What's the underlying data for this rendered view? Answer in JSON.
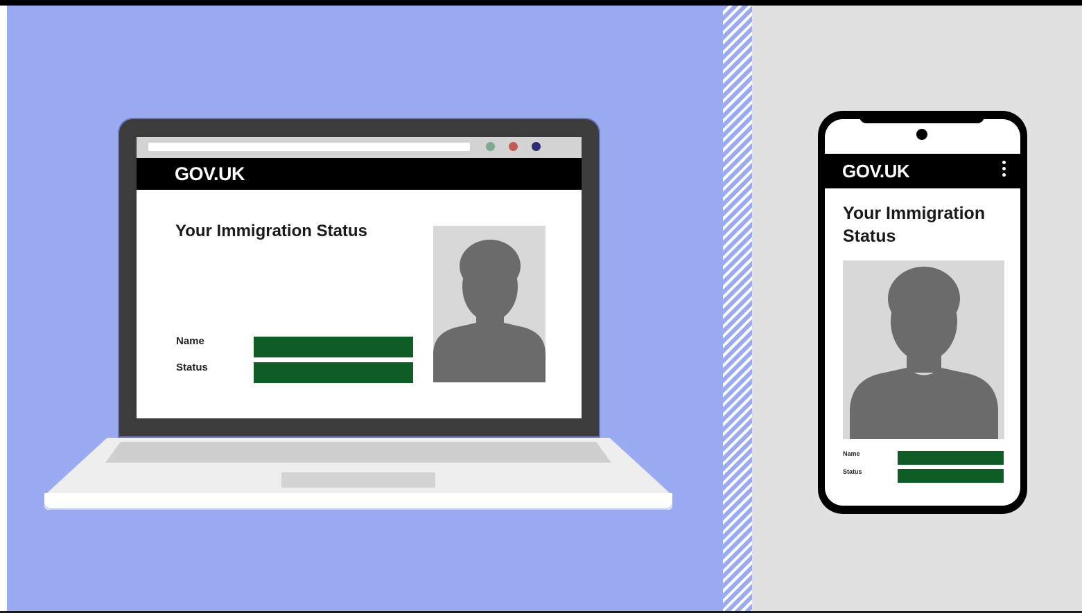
{
  "laptop": {
    "site_name": "GOV.UK",
    "page_title": "Your Immigration Status",
    "fields": {
      "name_label": "Name",
      "status_label": "Status"
    },
    "window_controls": [
      "green-dot",
      "red-dot",
      "navy-dot"
    ]
  },
  "phone": {
    "site_name": "GOV.UK",
    "page_title": "Your Immigration Status",
    "menu_icon": "kebab-menu-icon",
    "fields": {
      "name_label": "Name",
      "status_label": "Status"
    }
  },
  "colors": {
    "left_background": "#9aabf2",
    "right_background": "#e1e1e1",
    "gov_header": "#000000",
    "value_bar": "#0f5d26",
    "photo_background": "#d8d8d8",
    "silhouette": "#6b6b6b"
  }
}
